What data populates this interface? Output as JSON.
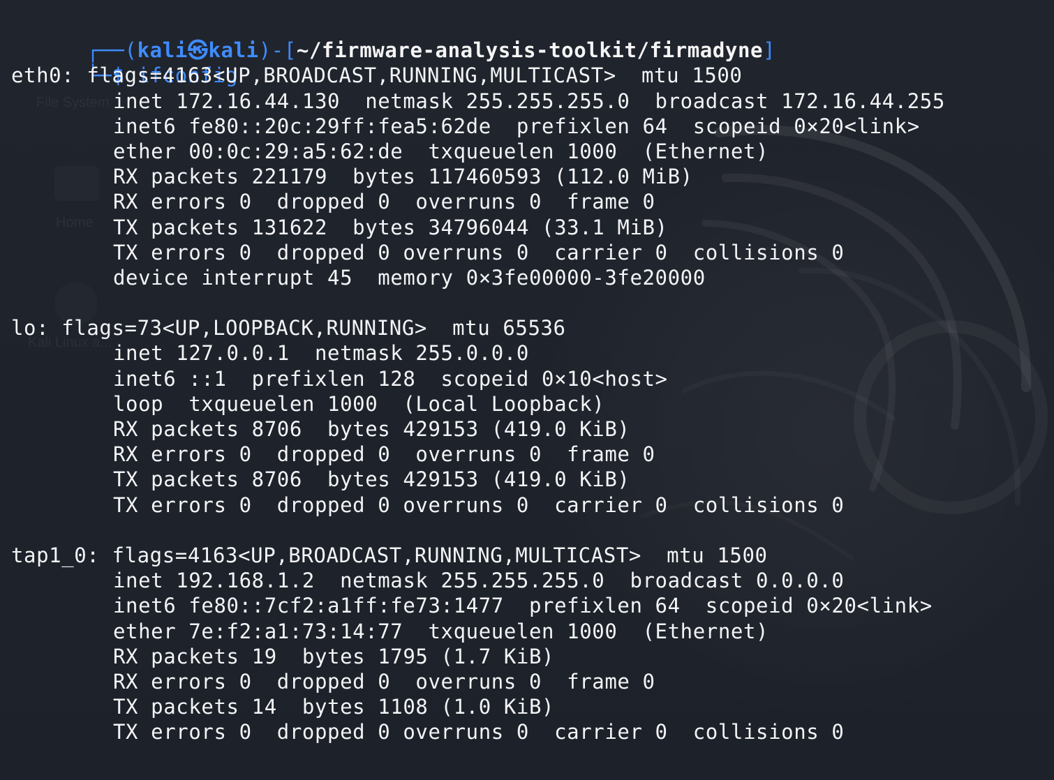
{
  "background": {
    "sidebar_labels": [
      "File System",
      "Home",
      "Kali Linux a..."
    ],
    "home_icon": "home-icon",
    "disk_icon": "disk-icon",
    "wallpaper_icon": "dragon-wallpaper"
  },
  "prompt": {
    "left_bracket": "┌──(",
    "user": "kali",
    "skull": "㉿",
    "host": "kali",
    "mid_bracket": ")-[",
    "path": "~/firmware-analysis-toolkit/firmadyne",
    "right_bracket": "]",
    "second_line_prefix": "└─",
    "symbol": "$",
    "command": "ifconfig"
  },
  "output": [
    "eth0: flags=4163<UP,BROADCAST,RUNNING,MULTICAST>  mtu 1500",
    "inet 172.16.44.130  netmask 255.255.255.0  broadcast 172.16.44.255",
    "inet6 fe80::20c:29ff:fea5:62de  prefixlen 64  scopeid 0×20<link>",
    "ether 00:0c:29:a5:62:de  txqueuelen 1000  (Ethernet)",
    "RX packets 221179  bytes 117460593 (112.0 MiB)",
    "RX errors 0  dropped 0  overruns 0  frame 0",
    "TX packets 131622  bytes 34796044 (33.1 MiB)",
    "TX errors 0  dropped 0 overruns 0  carrier 0  collisions 0",
    "device interrupt 45  memory 0×3fe00000-3fe20000",
    "",
    "lo: flags=73<UP,LOOPBACK,RUNNING>  mtu 65536",
    "inet 127.0.0.1  netmask 255.0.0.0",
    "inet6 ::1  prefixlen 128  scopeid 0×10<host>",
    "loop  txqueuelen 1000  (Local Loopback)",
    "RX packets 8706  bytes 429153 (419.0 KiB)",
    "RX errors 0  dropped 0  overruns 0  frame 0",
    "TX packets 8706  bytes 429153 (419.0 KiB)",
    "TX errors 0  dropped 0 overruns 0  carrier 0  collisions 0",
    "",
    "tap1_0: flags=4163<UP,BROADCAST,RUNNING,MULTICAST>  mtu 1500",
    "inet 192.168.1.2  netmask 255.255.255.0  broadcast 0.0.0.0",
    "inet6 fe80::7cf2:a1ff:fe73:1477  prefixlen 64  scopeid 0×20<link>",
    "ether 7e:f2:a1:73:14:77  txqueuelen 1000  (Ethernet)",
    "RX packets 19  bytes 1795 (1.7 KiB)",
    "RX errors 0  dropped 0  overruns 0  frame 0",
    "TX packets 14  bytes 1108 (1.0 KiB)",
    "TX errors 0  dropped 0 overruns 0  carrier 0  collisions 0"
  ]
}
